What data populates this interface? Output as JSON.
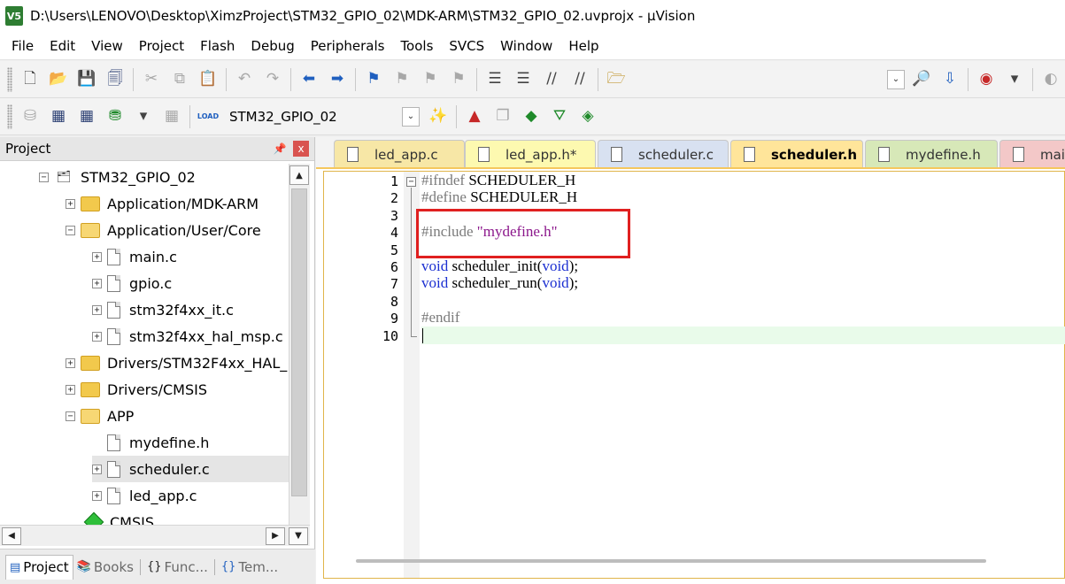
{
  "window": {
    "logo": "V5",
    "title": "D:\\Users\\LENOVO\\Desktop\\XimzProject\\STM32_GPIO_02\\MDK-ARM\\STM32_GPIO_02.uvprojx - µVision"
  },
  "menu": [
    "File",
    "Edit",
    "View",
    "Project",
    "Flash",
    "Debug",
    "Peripherals",
    "Tools",
    "SVCS",
    "Window",
    "Help"
  ],
  "toolbar": {
    "load_label": "LOAD",
    "target": "STM32_GPIO_02"
  },
  "project_panel": {
    "title": "Project",
    "pin": "ᵖ",
    "close": "x",
    "tree": [
      {
        "label": "STM32_GPIO_02",
        "kind": "root",
        "level": 0
      },
      {
        "label": "Application/MDK-ARM",
        "kind": "folder",
        "level": 1
      },
      {
        "label": "Application/User/Core",
        "kind": "folder-open",
        "level": 1
      },
      {
        "label": "main.c",
        "kind": "file",
        "level": 2
      },
      {
        "label": "gpio.c",
        "kind": "file",
        "level": 2
      },
      {
        "label": "stm32f4xx_it.c",
        "kind": "file",
        "level": 2
      },
      {
        "label": "stm32f4xx_hal_msp.c",
        "kind": "file",
        "level": 2
      },
      {
        "label": "Drivers/STM32F4xx_HAL_",
        "kind": "folder",
        "level": 1
      },
      {
        "label": "Drivers/CMSIS",
        "kind": "folder",
        "level": 1
      },
      {
        "label": "APP",
        "kind": "folder-open",
        "level": 1
      },
      {
        "label": "mydefine.h",
        "kind": "file-noexp",
        "level": 2
      },
      {
        "label": "scheduler.c",
        "kind": "file",
        "level": 2,
        "selected": true
      },
      {
        "label": "led_app.c",
        "kind": "file",
        "level": 2
      },
      {
        "label": "CMSIS",
        "kind": "cmsis",
        "level": 1
      }
    ],
    "tabs": [
      {
        "label": "Project",
        "active": true
      },
      {
        "label": "Books"
      },
      {
        "label": "Func..."
      },
      {
        "label": "Tem..."
      }
    ]
  },
  "editor": {
    "tabs": [
      {
        "label": "led_app.c",
        "color": "#f7e7a6"
      },
      {
        "label": "led_app.h*",
        "color": "#fdf9b0"
      },
      {
        "label": "scheduler.c",
        "color": "#d8e1f1"
      },
      {
        "label": "scheduler.h",
        "color": "#ffe59a",
        "active": true
      },
      {
        "label": "mydefine.h",
        "color": "#d7e8b8"
      },
      {
        "label": "main.c",
        "color": "#f3c8c8"
      }
    ],
    "line_numbers": [
      "1",
      "2",
      "3",
      "4",
      "5",
      "6",
      "7",
      "8",
      "9",
      "10"
    ],
    "lines": {
      "l1": {
        "pre": "#ifndef",
        "text": " SCHEDULER_H"
      },
      "l2": {
        "pre": "#define",
        "text": " SCHEDULER_H"
      },
      "l4": {
        "pre": "#include",
        "str": " \"mydefine.h\""
      },
      "l6": {
        "kw": "void",
        "text": " scheduler_init(",
        "kw2": "void",
        "text2": ");"
      },
      "l7": {
        "kw": "void",
        "text": " scheduler_run(",
        "kw2": "void",
        "text2": ");"
      },
      "l9": {
        "pre": "#endif"
      }
    }
  },
  "colors": {
    "highlight_box": "#e02020",
    "keyword": "#1b2fd1",
    "string": "#8b168b",
    "preprocessor": "#7b7b7b",
    "current_line": "#e9fbea"
  }
}
